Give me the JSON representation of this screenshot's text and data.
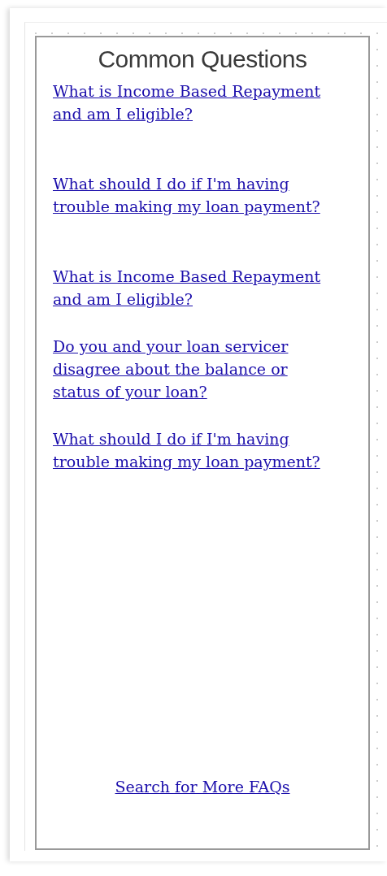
{
  "panel": {
    "title": "Common Questions",
    "questions": [
      {
        "text": "What is Income Based Repayment and am I eligible?"
      },
      {
        "text": "What should I do if I'm having trouble making my loan payment?"
      },
      {
        "text": "What is Income Based Repayment and am I eligible?"
      },
      {
        "text": "Do you and your loan servicer disagree about the balance or status of your loan?"
      },
      {
        "text": "What should I do if I'm having trouble making my loan payment?"
      }
    ],
    "more_link": "Search for More FAQs"
  }
}
